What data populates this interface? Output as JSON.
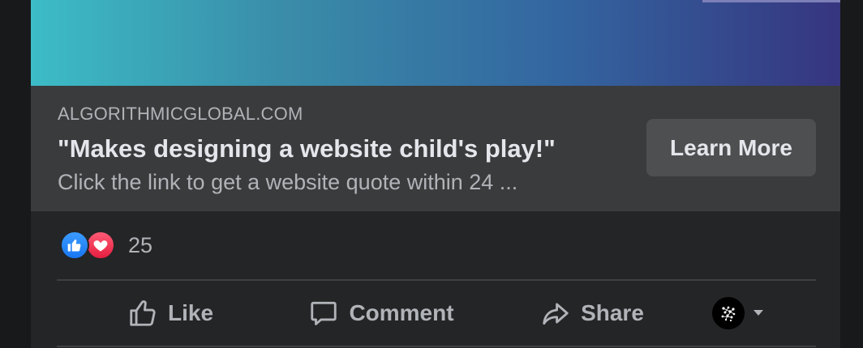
{
  "ad": {
    "domain": "ALGORITHMICGLOBAL.COM",
    "headline": "\"Makes designing a website child's play!\"",
    "description": "Click the link to get a website quote within 24 ...",
    "cta_label": "Learn More",
    "image_gradient": [
      "#3cbcc6",
      "#3366a0",
      "#36357f"
    ]
  },
  "reactions": {
    "types": [
      "like-icon",
      "love-icon"
    ],
    "count": "25"
  },
  "actions": {
    "like_label": "Like",
    "comment_label": "Comment",
    "share_label": "Share"
  },
  "colors": {
    "card_bg": "#242526",
    "preview_bg": "#3a3b3c",
    "button_bg": "#4e4f50",
    "text_primary": "#e4e6eb",
    "text_secondary": "#b0b3b8",
    "like_blue": "#1877f2",
    "love_red": "#e41e3f"
  }
}
